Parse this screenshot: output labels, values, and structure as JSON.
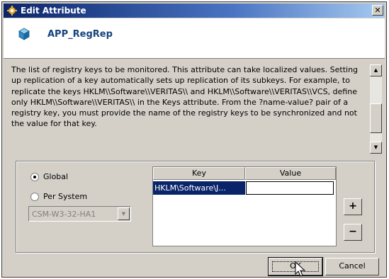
{
  "window": {
    "title": "Edit Attribute",
    "close_glyph": "✕",
    "app_icon": "gear-icon"
  },
  "header": {
    "resource_icon": "cube-icon",
    "resource_name": "APP_RegRep"
  },
  "description": "The list of registry keys to be monitored. This attribute can take localized values. Setting up replication of a key automatically sets up replication of its subkeys. For example, to replicate the keys HKLM\\\\Software\\\\VERITAS\\\\ and HKLM\\\\Software\\\\VERITAS\\\\VCS, define only HKLM\\\\Software\\\\VERITAS\\\\ in the Keys attribute. From the ?name-value? pair of a registry key, you must provide the name of the registry keys to be synchronized and not the value for that key.",
  "scope": {
    "global_label": "Global",
    "per_system_label": "Per System",
    "selected": "Global",
    "system_value": "CSM-W3-32-HA1"
  },
  "table": {
    "columns": [
      "Key",
      "Value"
    ],
    "rows": [
      {
        "key": "HKLM\\Software\\J...",
        "value": ""
      }
    ]
  },
  "side_buttons": {
    "add": "+",
    "remove": "−"
  },
  "buttons": {
    "ok": "OK",
    "cancel": "Cancel"
  },
  "colors": {
    "title_bar": "#0a246a",
    "resource_name": "#16437e",
    "selection": "#0a246a"
  }
}
